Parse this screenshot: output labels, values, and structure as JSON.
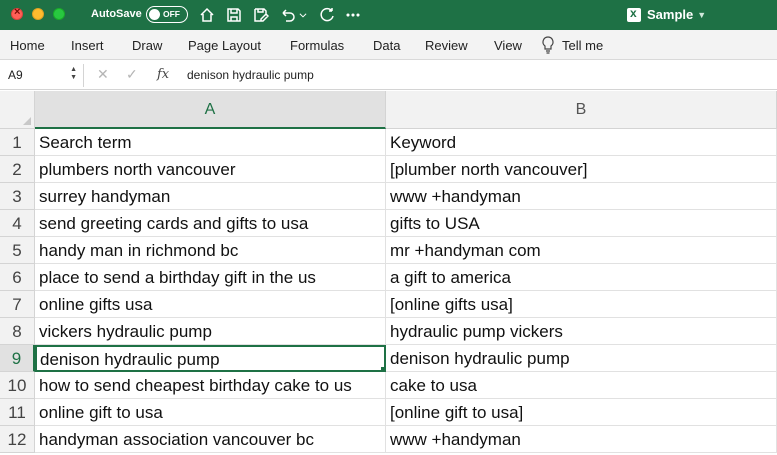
{
  "titlebar": {
    "autosave_label": "AutoSave",
    "autosave_state": "OFF",
    "document_title": "Sample",
    "icons": [
      "home-icon",
      "save-icon",
      "save-as-icon",
      "undo-icon",
      "redo-icon",
      "more-icon"
    ]
  },
  "ribbon": {
    "tabs": [
      "Home",
      "Insert",
      "Draw",
      "Page Layout",
      "Formulas",
      "Data",
      "Review",
      "View"
    ],
    "tell_me": "Tell me"
  },
  "formula_bar": {
    "name_box": "A9",
    "fx": "fx",
    "value": "denison hydraulic pump"
  },
  "sheet": {
    "columns": [
      "A",
      "B"
    ],
    "selected_cell": "A9",
    "rows": [
      {
        "num": "1",
        "a": "Search term",
        "b": "Keyword"
      },
      {
        "num": "2",
        "a": "plumbers north vancouver",
        "b": "[plumber north vancouver]"
      },
      {
        "num": "3",
        "a": "surrey handyman",
        "b": "www +handyman"
      },
      {
        "num": "4",
        "a": "send greeting cards and gifts to usa",
        "b": "gifts to USA"
      },
      {
        "num": "5",
        "a": "handy man in richmond bc",
        "b": "mr +handyman com"
      },
      {
        "num": "6",
        "a": "place to send a birthday gift in the us",
        "b": "a gift to america"
      },
      {
        "num": "7",
        "a": "online gifts usa",
        "b": "[online gifts usa]"
      },
      {
        "num": "8",
        "a": "vickers hydraulic pump",
        "b": "hydraulic pump vickers"
      },
      {
        "num": "9",
        "a": "denison hydraulic pump",
        "b": "denison hydraulic pump"
      },
      {
        "num": "10",
        "a": "how to send cheapest birthday cake to us",
        "b": "cake to usa"
      },
      {
        "num": "11",
        "a": "online gift to usa",
        "b": "[online gift to usa]"
      },
      {
        "num": "12",
        "a": "handyman association vancouver bc",
        "b": "www +handyman"
      }
    ]
  },
  "colors": {
    "excel_green": "#1e7145",
    "header_gray": "#f2f2f2",
    "selected_header": "#e1e1e1"
  }
}
